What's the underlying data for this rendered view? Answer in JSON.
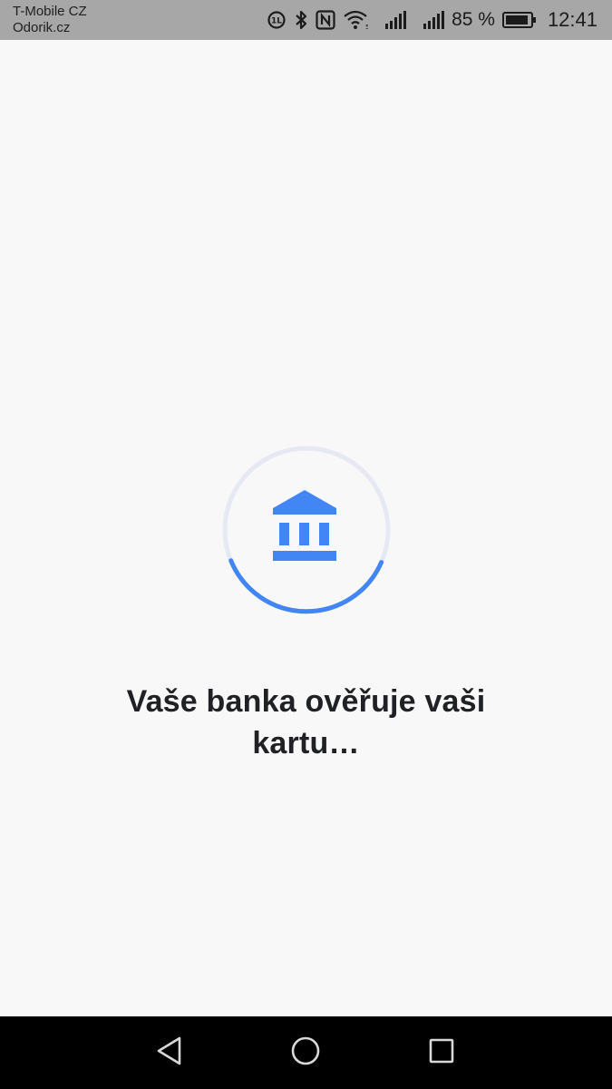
{
  "status_bar": {
    "carrier_line1": "T-Mobile CZ",
    "carrier_line2": "Odorik.cz",
    "battery_percent": "85 %",
    "time": "12:41",
    "icons": [
      "data-saver-icon",
      "bluetooth-icon",
      "nfc-icon",
      "wifi-icon",
      "signal-icon-1",
      "signal-icon-2",
      "battery-icon"
    ]
  },
  "main": {
    "icon": "bank-icon",
    "message": "Vaše banka ověřuje vaši kartu…",
    "colors": {
      "accent": "#4285f4",
      "track": "#e6e9f4",
      "text": "#202124",
      "background": "#f8f8f8"
    }
  },
  "nav_bar": {
    "buttons": [
      "back-icon",
      "home-icon",
      "recent-apps-icon"
    ]
  }
}
